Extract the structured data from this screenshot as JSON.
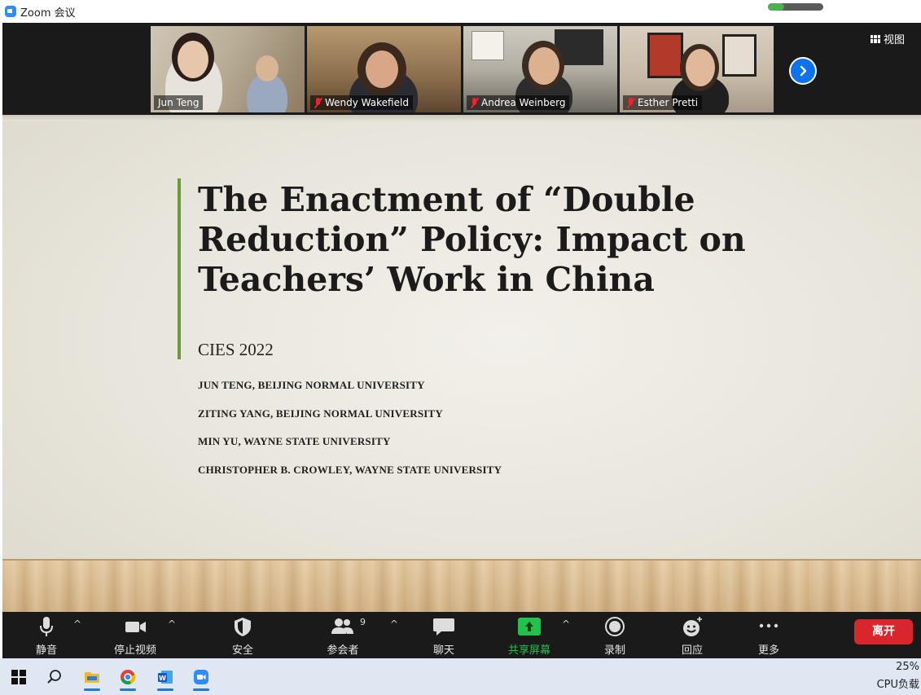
{
  "window": {
    "title": "Zoom 会议",
    "audio_level": 0.3
  },
  "participants": [
    {
      "name": "Jun Teng",
      "muted": false
    },
    {
      "name": "Wendy Wakefield",
      "muted": true
    },
    {
      "name": "Andrea Weinberg",
      "muted": true
    },
    {
      "name": "Esther Pretti",
      "muted": true
    }
  ],
  "view_button_label": "视图",
  "slide": {
    "title": "The Enactment of “Double Reduction” Policy: Impact on Teachers’ Work in China",
    "subtitle": "CIES 2022",
    "authors": [
      "JUN TENG, BEIJING NORMAL UNIVERSITY",
      "ZITING YANG, BEIJING NORMAL UNIVERSITY",
      "MIN YU, WAYNE STATE UNIVERSITY",
      "CHRISTOPHER B. CROWLEY, WAYNE STATE UNIVERSITY"
    ]
  },
  "toolbar": {
    "mute_label": "静音",
    "stop_video_label": "停止视频",
    "security_label": "安全",
    "participants_label": "参会者",
    "participants_count": "9",
    "chat_label": "聊天",
    "share_screen_label": "共享屏幕",
    "record_label": "录制",
    "reactions_label": "回应",
    "more_label": "更多",
    "leave_label": "离开"
  },
  "taskbar": {
    "cpu_percent": "25%",
    "cpu_label": "CPU负载"
  },
  "colors": {
    "zoom_blue": "#0e72ed",
    "leave_red": "#d9262c",
    "share_green": "#24c24b",
    "slide_accent": "#6a9a3a"
  }
}
